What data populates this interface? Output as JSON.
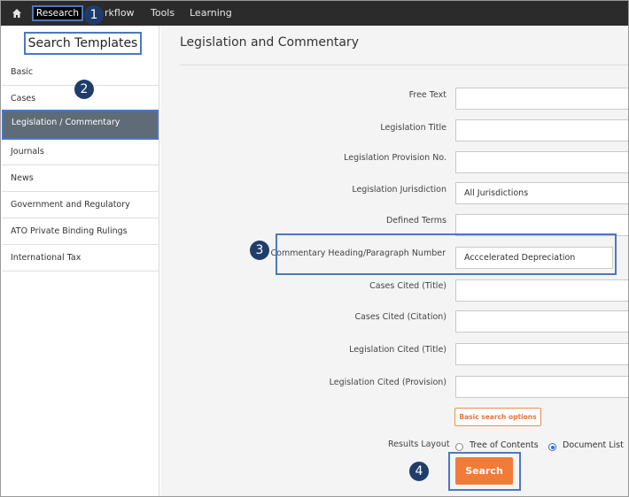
{
  "topnav": {
    "items": [
      "Research",
      "Workflow",
      "Tools",
      "Learning"
    ],
    "workflow_visible": "rkflow"
  },
  "sidebar": {
    "heading": "Search Templates",
    "items": [
      "Basic",
      "Cases",
      "Legislation / Commentary",
      "Journals",
      "News",
      "Government and Regulatory",
      "ATO Private Binding Rulings",
      "International Tax"
    ],
    "active_index": 2
  },
  "main": {
    "title": "Legislation and Commentary",
    "fields": [
      {
        "label": "Free Text",
        "value": ""
      },
      {
        "label": "Legislation Title",
        "value": ""
      },
      {
        "label": "Legislation Provision No.",
        "value": ""
      },
      {
        "label": "Legislation Jurisdiction",
        "value": "All Jurisdictions"
      },
      {
        "label": "Defined Terms",
        "value": ""
      },
      {
        "label": "Commentary Heading/Paragraph Number",
        "value": "Acccelerated Depreciation"
      },
      {
        "label": "Cases Cited (Title)",
        "value": ""
      },
      {
        "label": "Cases Cited (Citation)",
        "value": ""
      },
      {
        "label": "Legislation Cited (Title)",
        "value": ""
      },
      {
        "label": "Legislation Cited (Provision)",
        "value": ""
      }
    ],
    "basic_search_options": "Basic search options",
    "results_layout": {
      "label": "Results Layout",
      "options": [
        "Tree of Contents",
        "Document List"
      ],
      "selected": "Document List"
    },
    "search_button": "Search"
  },
  "badges": [
    "1",
    "2",
    "3",
    "4"
  ],
  "colors": {
    "topnav_bg": "#2b2b2b",
    "highlight": "#4a78c2",
    "badge": "#1f3d6b",
    "active_item": "#5f6b76",
    "search_button": "#f27b38"
  }
}
